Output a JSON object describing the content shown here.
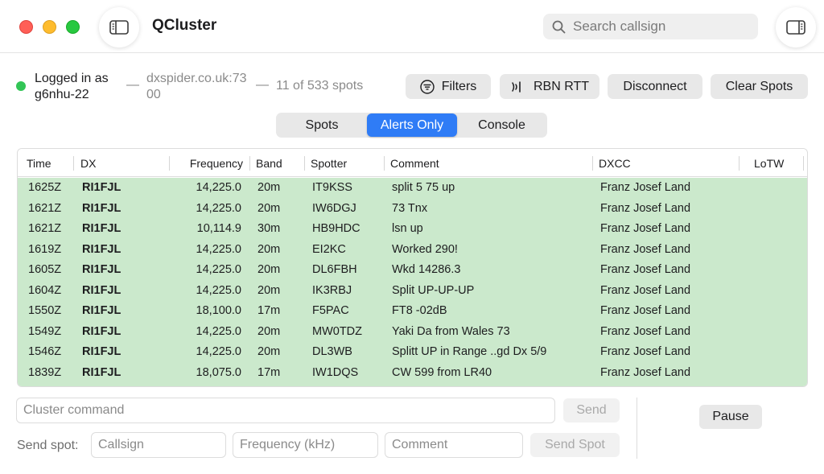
{
  "window": {
    "title": "QCluster",
    "search_placeholder": "Search callsign"
  },
  "colors": {
    "accent": "#2f7cf6",
    "status_connected": "#32c556",
    "alert_row_bg": "#cbe9cc"
  },
  "icons": {
    "left_toggle": "sidebar-left-icon",
    "right_toggle": "sidebar-right-icon",
    "search": "magnifier-icon",
    "filters": "filter-lines-icon",
    "rbn": "signal-waves-icon"
  },
  "status": {
    "logged_in": "Logged in as g6nhu-22",
    "separator": "—",
    "host": "dxspider.co.uk:7300",
    "spots_count": "11 of 533 spots"
  },
  "toolbar": {
    "filters": "Filters",
    "rbn": "RBN RTT",
    "disconnect": "Disconnect",
    "clear_spots": "Clear Spots"
  },
  "tabs": {
    "items": [
      "Spots",
      "Alerts Only",
      "Console"
    ],
    "selected": "Alerts Only"
  },
  "table": {
    "columns": [
      "Time",
      "DX",
      "Frequency",
      "Band",
      "Spotter",
      "Comment",
      "DXCC",
      "LoTW"
    ],
    "rows": [
      {
        "time": "1625Z",
        "dx": "RI1FJL",
        "freq": "14,225.0",
        "band": "20m",
        "spotter": "IT9KSS",
        "comment": "split 5 75 up",
        "dxcc": "Franz Josef Land",
        "lotw": ""
      },
      {
        "time": "1621Z",
        "dx": "RI1FJL",
        "freq": "14,225.0",
        "band": "20m",
        "spotter": "IW6DGJ",
        "comment": "73 Tnx",
        "dxcc": "Franz Josef Land",
        "lotw": ""
      },
      {
        "time": "1621Z",
        "dx": "RI1FJL",
        "freq": "10,114.9",
        "band": "30m",
        "spotter": "HB9HDC",
        "comment": "lsn up",
        "dxcc": "Franz Josef Land",
        "lotw": ""
      },
      {
        "time": "1619Z",
        "dx": "RI1FJL",
        "freq": "14,225.0",
        "band": "20m",
        "spotter": "EI2KC",
        "comment": "Worked 290!",
        "dxcc": "Franz Josef Land",
        "lotw": ""
      },
      {
        "time": "1605Z",
        "dx": "RI1FJL",
        "freq": "14,225.0",
        "band": "20m",
        "spotter": "DL6FBH",
        "comment": "Wkd 14286.3",
        "dxcc": "Franz Josef Land",
        "lotw": ""
      },
      {
        "time": "1604Z",
        "dx": "RI1FJL",
        "freq": "14,225.0",
        "band": "20m",
        "spotter": "IK3RBJ",
        "comment": "Split UP-UP-UP",
        "dxcc": "Franz Josef Land",
        "lotw": ""
      },
      {
        "time": "1550Z",
        "dx": "RI1FJL",
        "freq": "18,100.0",
        "band": "17m",
        "spotter": "F5PAC",
        "comment": "FT8 -02dB",
        "dxcc": "Franz Josef Land",
        "lotw": ""
      },
      {
        "time": "1549Z",
        "dx": "RI1FJL",
        "freq": "14,225.0",
        "band": "20m",
        "spotter": "MW0TDZ",
        "comment": "Yaki Da from Wales 73",
        "dxcc": "Franz Josef Land",
        "lotw": ""
      },
      {
        "time": "1546Z",
        "dx": "RI1FJL",
        "freq": "14,225.0",
        "band": "20m",
        "spotter": "DL3WB",
        "comment": "Splitt UP in Range ..gd Dx 5/9",
        "dxcc": "Franz Josef Land",
        "lotw": ""
      },
      {
        "time": "1839Z",
        "dx": "RI1FJL",
        "freq": "18,075.0",
        "band": "17m",
        "spotter": "IW1DQS",
        "comment": "CW 599 from LR40",
        "dxcc": "Franz Josef Land",
        "lotw": ""
      }
    ]
  },
  "command": {
    "placeholder": "Cluster command",
    "value": "",
    "send": "Send"
  },
  "spot_form": {
    "label": "Send spot:",
    "callsign_placeholder": "Callsign",
    "frequency_placeholder": "Frequency (kHz)",
    "comment_placeholder": "Comment",
    "send_spot": "Send Spot"
  },
  "pause": "Pause"
}
